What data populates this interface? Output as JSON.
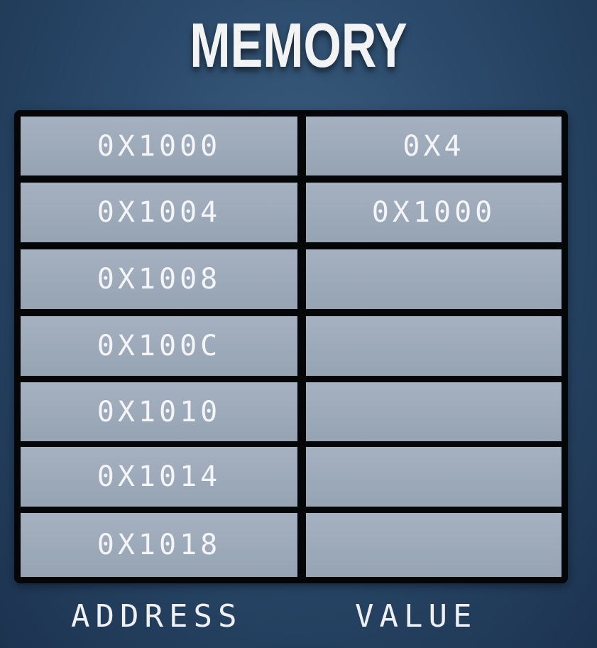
{
  "title": "MEMORY",
  "rows": [
    {
      "address": "0X1000",
      "value": "0X4"
    },
    {
      "address": "0X1004",
      "value": "0X1000"
    },
    {
      "address": "0X1008",
      "value": ""
    },
    {
      "address": "0X100C",
      "value": ""
    },
    {
      "address": "0X1010",
      "value": ""
    },
    {
      "address": "0X1014",
      "value": ""
    },
    {
      "address": "0X1018",
      "value": ""
    }
  ],
  "labels": {
    "address": "ADDRESS",
    "value": "VALUE"
  }
}
